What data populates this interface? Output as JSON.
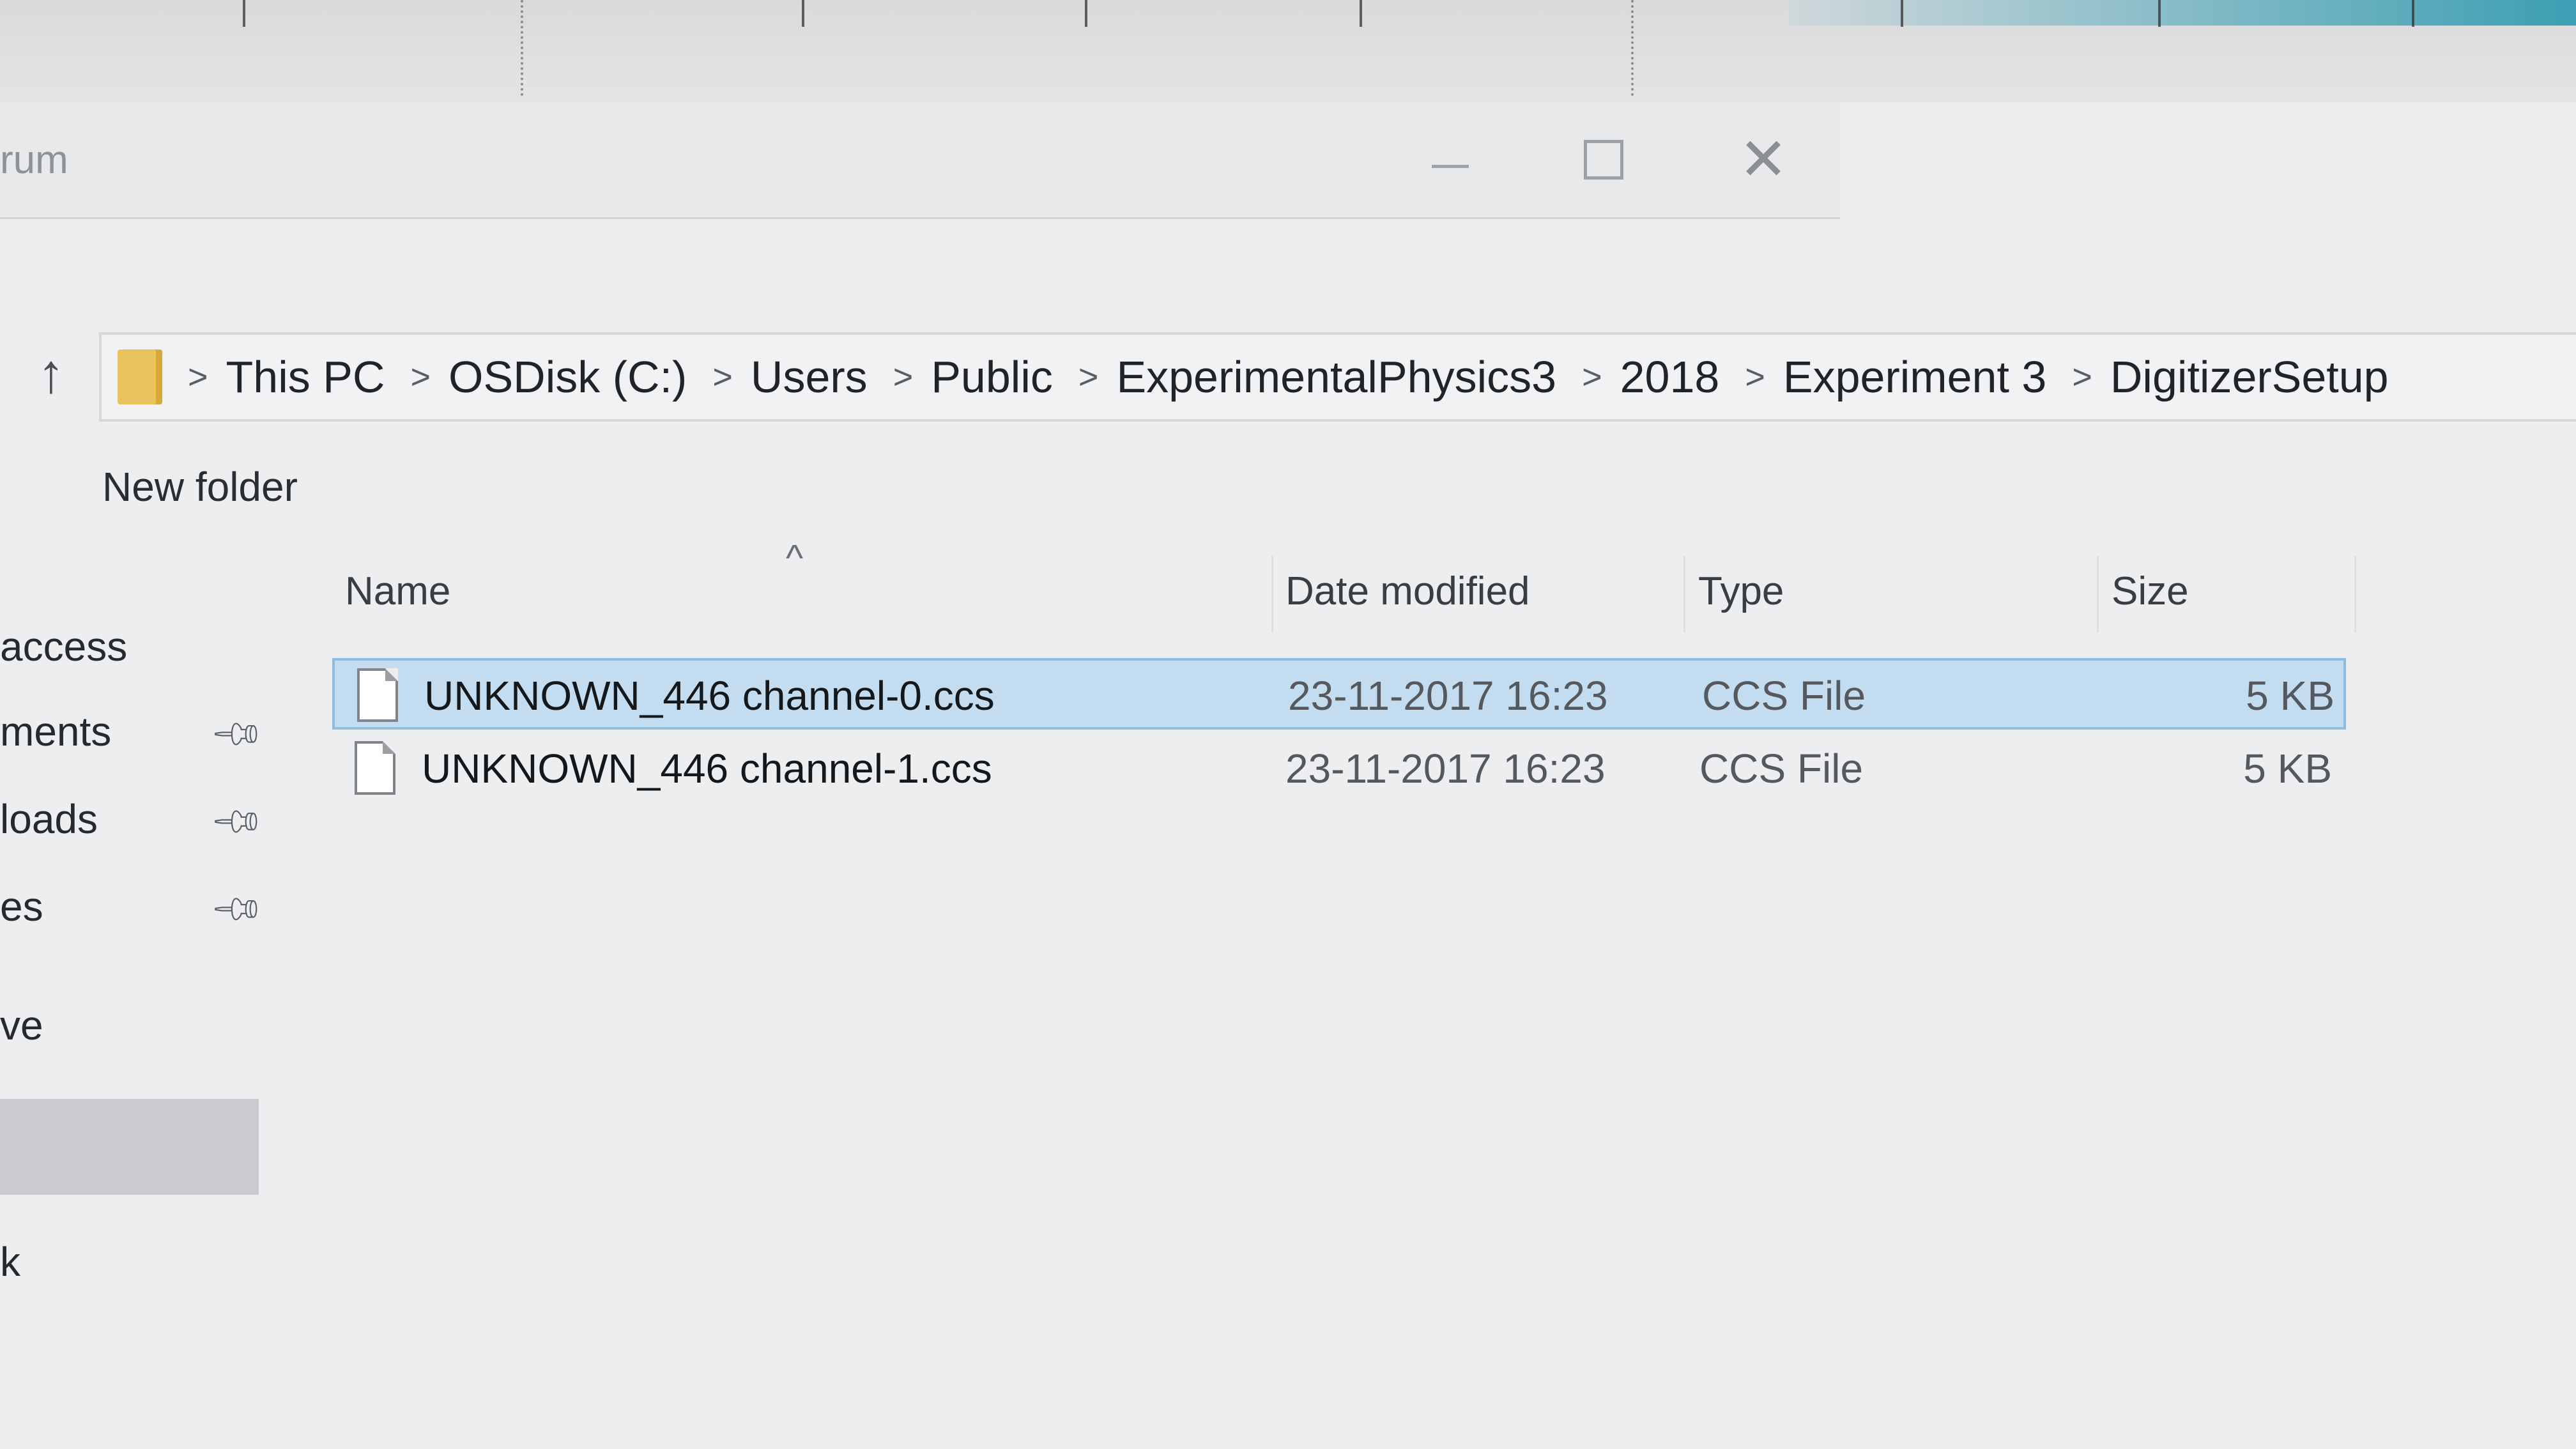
{
  "window": {
    "title_fragment": "rum",
    "controls": {
      "minimize": "minimize",
      "maximize": "maximize",
      "close": "close"
    }
  },
  "address_bar": {
    "crumbs": [
      "This PC",
      "OSDisk (C:)",
      "Users",
      "Public",
      "ExperimentalPhysics3",
      "2018",
      "Experiment 3",
      "DigitizerSetup"
    ]
  },
  "command_bar": {
    "new_folder_label": "New folder"
  },
  "sidebar": {
    "items": [
      {
        "label": "access",
        "pinned": false
      },
      {
        "label": "ments",
        "pinned": true
      },
      {
        "label": "loads",
        "pinned": true
      },
      {
        "label": "es",
        "pinned": true
      },
      {
        "label": "ve",
        "pinned": false
      },
      {
        "label": "k",
        "pinned": false
      }
    ]
  },
  "file_list": {
    "sort_indicator": "^",
    "columns": {
      "name": "Name",
      "date": "Date modified",
      "type": "Type",
      "size": "Size"
    },
    "rows": [
      {
        "name": "UNKNOWN_446 channel-0.ccs",
        "date": "23-11-2017 16:23",
        "type": "CCS File",
        "size": "5 KB",
        "selected": true
      },
      {
        "name": "UNKNOWN_446 channel-1.ccs",
        "date": "23-11-2017 16:23",
        "type": "CCS File",
        "size": "5 KB",
        "selected": false
      }
    ]
  },
  "colors": {
    "selection": "#c4dcef",
    "selection_border": "#8fbde0",
    "folder": "#e8c25a"
  }
}
